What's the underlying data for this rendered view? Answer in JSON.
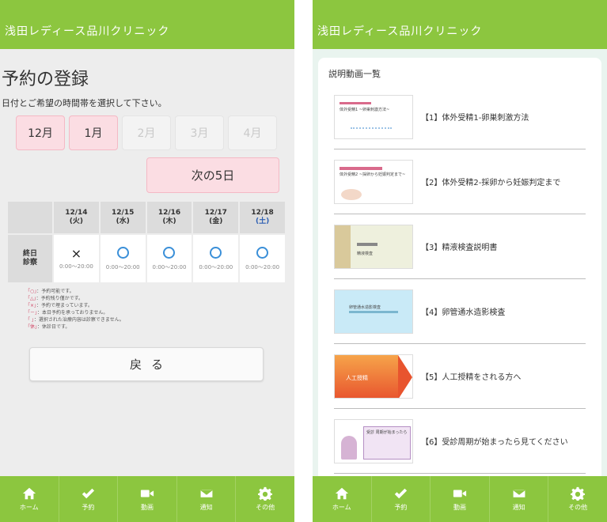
{
  "app_title": "浅田レディース品川クリニック",
  "left": {
    "page_title": "予約の登録",
    "instruction": "日付とご希望の時間帯を選択して下さい。",
    "months": [
      {
        "label": "12月",
        "state": "active"
      },
      {
        "label": "1月",
        "state": "active"
      },
      {
        "label": "2月",
        "state": "disabled"
      },
      {
        "label": "3月",
        "state": "disabled"
      },
      {
        "label": "4月",
        "state": "disabled"
      }
    ],
    "next_button": "次の5日",
    "row_header_line1": "終日",
    "row_header_line2": "診察",
    "days": [
      {
        "date": "12/14",
        "weekday": "(火)",
        "mark": "×",
        "time": "0:00～20:00"
      },
      {
        "date": "12/15",
        "weekday": "(水)",
        "mark": "○",
        "time": "0:00～20:00"
      },
      {
        "date": "12/16",
        "weekday": "(木)",
        "mark": "○",
        "time": "0:00～20:00"
      },
      {
        "date": "12/17",
        "weekday": "(金)",
        "mark": "○",
        "time": "0:00～20:00"
      },
      {
        "date": "12/18",
        "weekday": "(土)",
        "mark": "○",
        "time": "0:00～20:00"
      }
    ],
    "legend": [
      {
        "key": "「○」",
        "text": "：予約可能です。"
      },
      {
        "key": "「△」",
        "text": "：予約残り僅かです。"
      },
      {
        "key": "「×」",
        "text": "：予約で埋まっています。"
      },
      {
        "key": "「－」",
        "text": "：本日予約を承っておりません。"
      },
      {
        "key": "「 」",
        "text": "：選択された治療内容は診察できません。"
      },
      {
        "key": "「休」",
        "text": "：休診日です。"
      }
    ],
    "back_button": "戻る"
  },
  "right": {
    "section_title": "説明動画一覧",
    "videos": [
      {
        "label": "【1】体外受精1-卵巣刺激方法",
        "thumb": "t1",
        "thumb_text": "体外受精1 ~卵巣刺激方法~"
      },
      {
        "label": "【2】体外受精2-採卵から妊娠判定まで",
        "thumb": "t2",
        "thumb_text": "体外受精2 ~採卵から妊娠判定まで~"
      },
      {
        "label": "【3】精液検査説明書",
        "thumb": "t3",
        "thumb_text": "精液検査"
      },
      {
        "label": "【4】卵管通水造影検査",
        "thumb": "t4",
        "thumb_text": "卵管通水造影検査"
      },
      {
        "label": "【5】人工授精をされる方へ",
        "thumb": "t5",
        "thumb_text": "人工授精"
      },
      {
        "label": "【6】受診周期が始まったら見てください",
        "thumb": "t6",
        "thumb_text": "受診 周期が始まったら"
      }
    ]
  },
  "tabs": [
    {
      "id": "home",
      "label": "ホーム",
      "icon": "home-icon"
    },
    {
      "id": "reserve",
      "label": "予約",
      "icon": "check-icon"
    },
    {
      "id": "video",
      "label": "動画",
      "icon": "video-camera-icon"
    },
    {
      "id": "notice",
      "label": "通知",
      "icon": "envelope-icon"
    },
    {
      "id": "other",
      "label": "その他",
      "icon": "gear-icon"
    }
  ]
}
